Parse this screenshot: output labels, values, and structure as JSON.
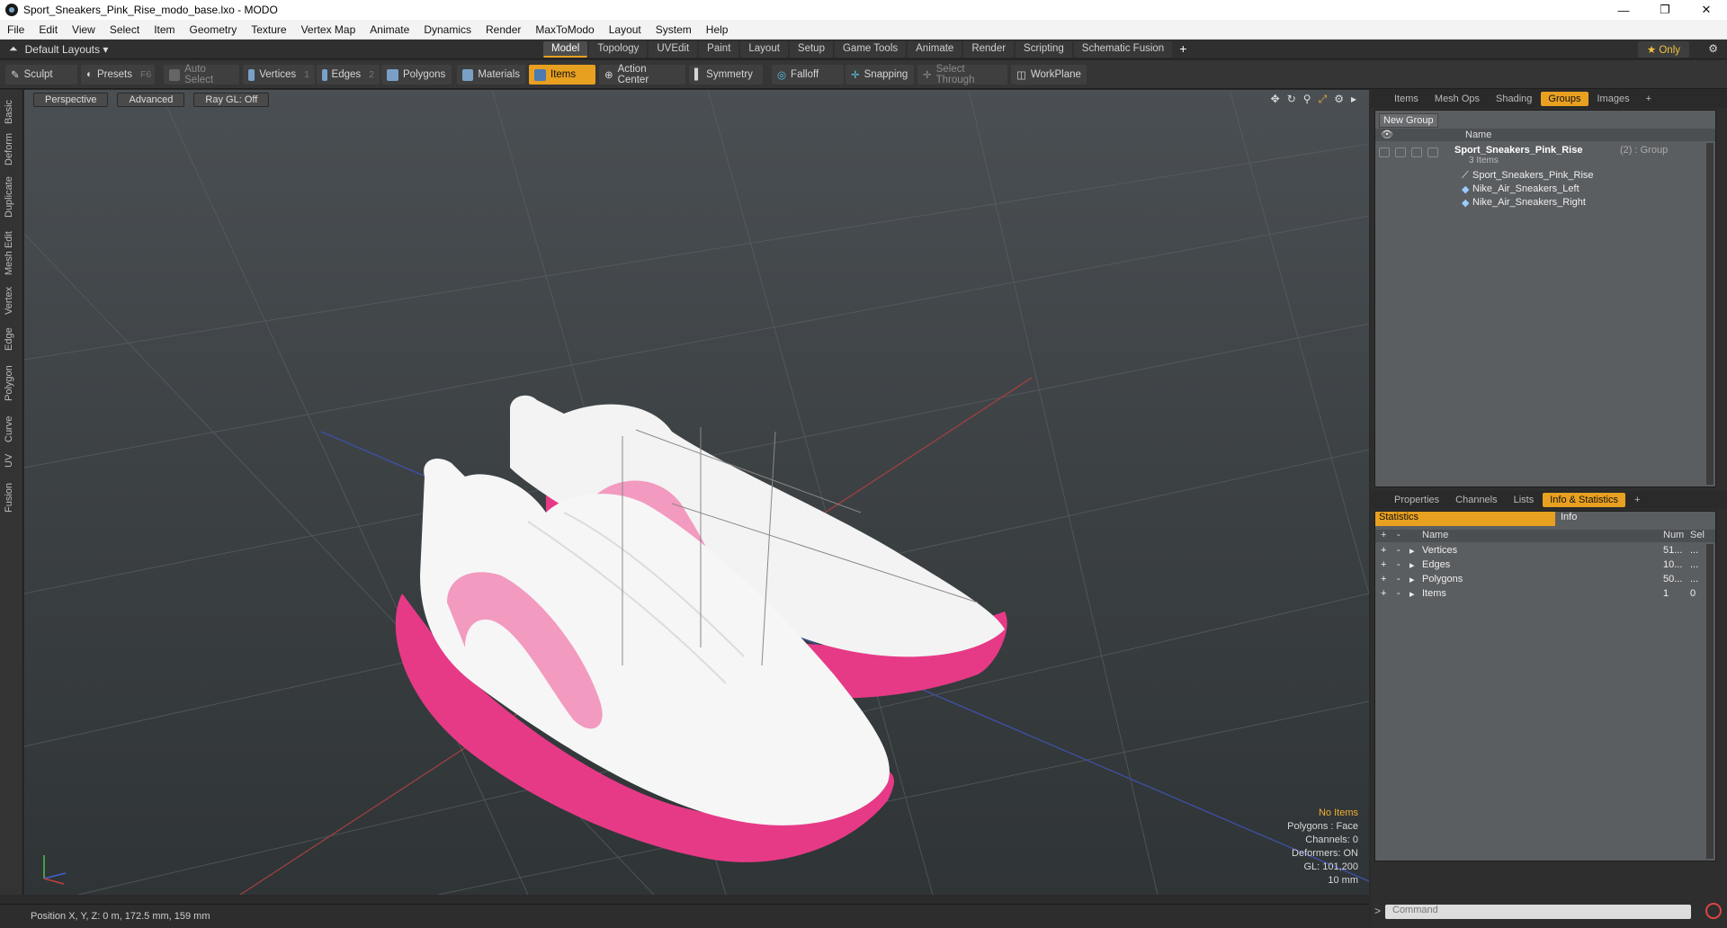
{
  "window": {
    "title": "Sport_Sneakers_Pink_Rise_modo_base.lxo - MODO",
    "controls": [
      "—",
      "❐",
      "✕"
    ]
  },
  "menu": [
    "File",
    "Edit",
    "View",
    "Select",
    "Item",
    "Geometry",
    "Texture",
    "Vertex Map",
    "Animate",
    "Dynamics",
    "Render",
    "MaxToModo",
    "Layout",
    "System",
    "Help"
  ],
  "layoutbar": {
    "layout_label": "Default Layouts ▾",
    "tabs": [
      "Model",
      "Topology",
      "UVEdit",
      "Paint",
      "Layout",
      "Setup",
      "Game Tools",
      "Animate",
      "Render",
      "Scripting",
      "Schematic Fusion"
    ],
    "active_tab": "Model",
    "add": "+",
    "only_label": "★ Only"
  },
  "toolbar": {
    "sculpt": "Sculpt",
    "presets": "Presets",
    "presets_key": "F6",
    "auto_select": "Auto Select",
    "vertices": "Vertices",
    "vertices_key": "1",
    "edges": "Edges",
    "edges_key": "2",
    "polygons": "Polygons",
    "materials": "Materials",
    "items": "Items",
    "action_center": "Action Center",
    "symmetry": "Symmetry",
    "falloff": "Falloff",
    "snapping": "Snapping",
    "select_through": "Select Through",
    "workplane": "WorkPlane"
  },
  "lefttabs": [
    "Basic",
    "Deform",
    "Duplicate",
    "Mesh Edit",
    "Vertex",
    "Edge",
    "Polygon",
    "Curve",
    "UV",
    "Fusion"
  ],
  "viewport": {
    "view_mode": "Perspective",
    "shading": "Advanced",
    "raygl": "Ray GL: Off",
    "info": {
      "no_items": "No Items",
      "polygons": "Polygons : Face",
      "channels": "Channels: 0",
      "deformers": "Deformers: ON",
      "gl": "GL: 101,200",
      "scale": "10 mm"
    }
  },
  "status": {
    "position": "Position X, Y, Z:  0 m, 172.5 mm, 159 mm"
  },
  "groups_panel": {
    "tabs": [
      "Items",
      "Mesh Ops",
      "Shading",
      "Groups",
      "Images",
      "+"
    ],
    "active_tab": "Groups",
    "new_group": "New Group",
    "header_name": "Name",
    "root": {
      "name": "Sport_Sneakers_Pink_Rise",
      "suffix": "(2) : Group",
      "count": "3 Items"
    },
    "children": [
      "Sport_Sneakers_Pink_Rise",
      "Nike_Air_Sneakers_Left",
      "Nike_Air_Sneakers_Right"
    ]
  },
  "stats_panel": {
    "tabs": [
      "Properties",
      "Channels",
      "Lists",
      "Info & Statistics",
      "+"
    ],
    "active_tab": "Info & Statistics",
    "sub_tabs": [
      "Statistics",
      "Info"
    ],
    "columns": [
      "Name",
      "Num",
      "Sel"
    ],
    "rows": [
      {
        "name": "Vertices",
        "num": "51...",
        "sel": "..."
      },
      {
        "name": "Edges",
        "num": "10...",
        "sel": "..."
      },
      {
        "name": "Polygons",
        "num": "50...",
        "sel": "..."
      },
      {
        "name": "Items",
        "num": "1",
        "sel": "0"
      }
    ]
  },
  "command": {
    "placeholder": "Command"
  },
  "colors": {
    "accent": "#e8a020",
    "sole_pink": "#e63a86",
    "upper_white": "#f4f4f4",
    "swoosh_pink": "#f39ac0"
  }
}
